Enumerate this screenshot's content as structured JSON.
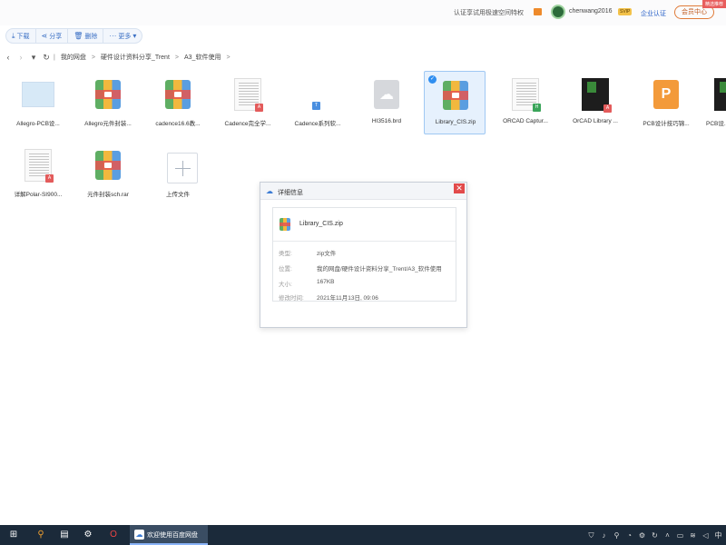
{
  "topbar": {
    "promo": "认证享试用极速空间特权",
    "username": "chenwang2016",
    "svip": "SVIP",
    "enterprise": "企业认证",
    "member": "会员中心",
    "corner": "精选推荐"
  },
  "toolbar": {
    "download": "下载",
    "share": "分享",
    "delete": "删除",
    "more": "更多"
  },
  "breadcrumb": [
    "我的网盘",
    "硬件设计资料分享_Trent",
    "A3_软件使用"
  ],
  "files": [
    {
      "name": "Allegro-PCB设..."
    },
    {
      "name": "Allegro元件封装..."
    },
    {
      "name": "cadence16.6教..."
    },
    {
      "name": "Cadence完全学..."
    },
    {
      "name": "Cadence系列软..."
    },
    {
      "name": "HI3516.brd"
    },
    {
      "name": "Library_CIS.zip"
    },
    {
      "name": "ORCAD Captur..."
    },
    {
      "name": "OrCAD Library ..."
    },
    {
      "name": "PCB设计技巧锦..."
    },
    {
      "name": "PCB设..."
    },
    {
      "name": "详解Polar-SI900..."
    },
    {
      "name": "元件封装sch.rar"
    },
    {
      "name": "上传文件"
    }
  ],
  "dialog": {
    "title": "详细信息",
    "file_name": "Library_CIS.zip",
    "rows": [
      {
        "key": "类型:",
        "value": "zip文件"
      },
      {
        "key": "位置:",
        "value": "我的网盘/硬件设计资料分享_Trent/A3_软件使用"
      },
      {
        "key": "大小:",
        "value": "167KB"
      },
      {
        "key": "修改时间:",
        "value": "2021年11月13日, 09:06"
      }
    ]
  },
  "taskbar": {
    "active_app": "欢迎使用百度网盘"
  }
}
